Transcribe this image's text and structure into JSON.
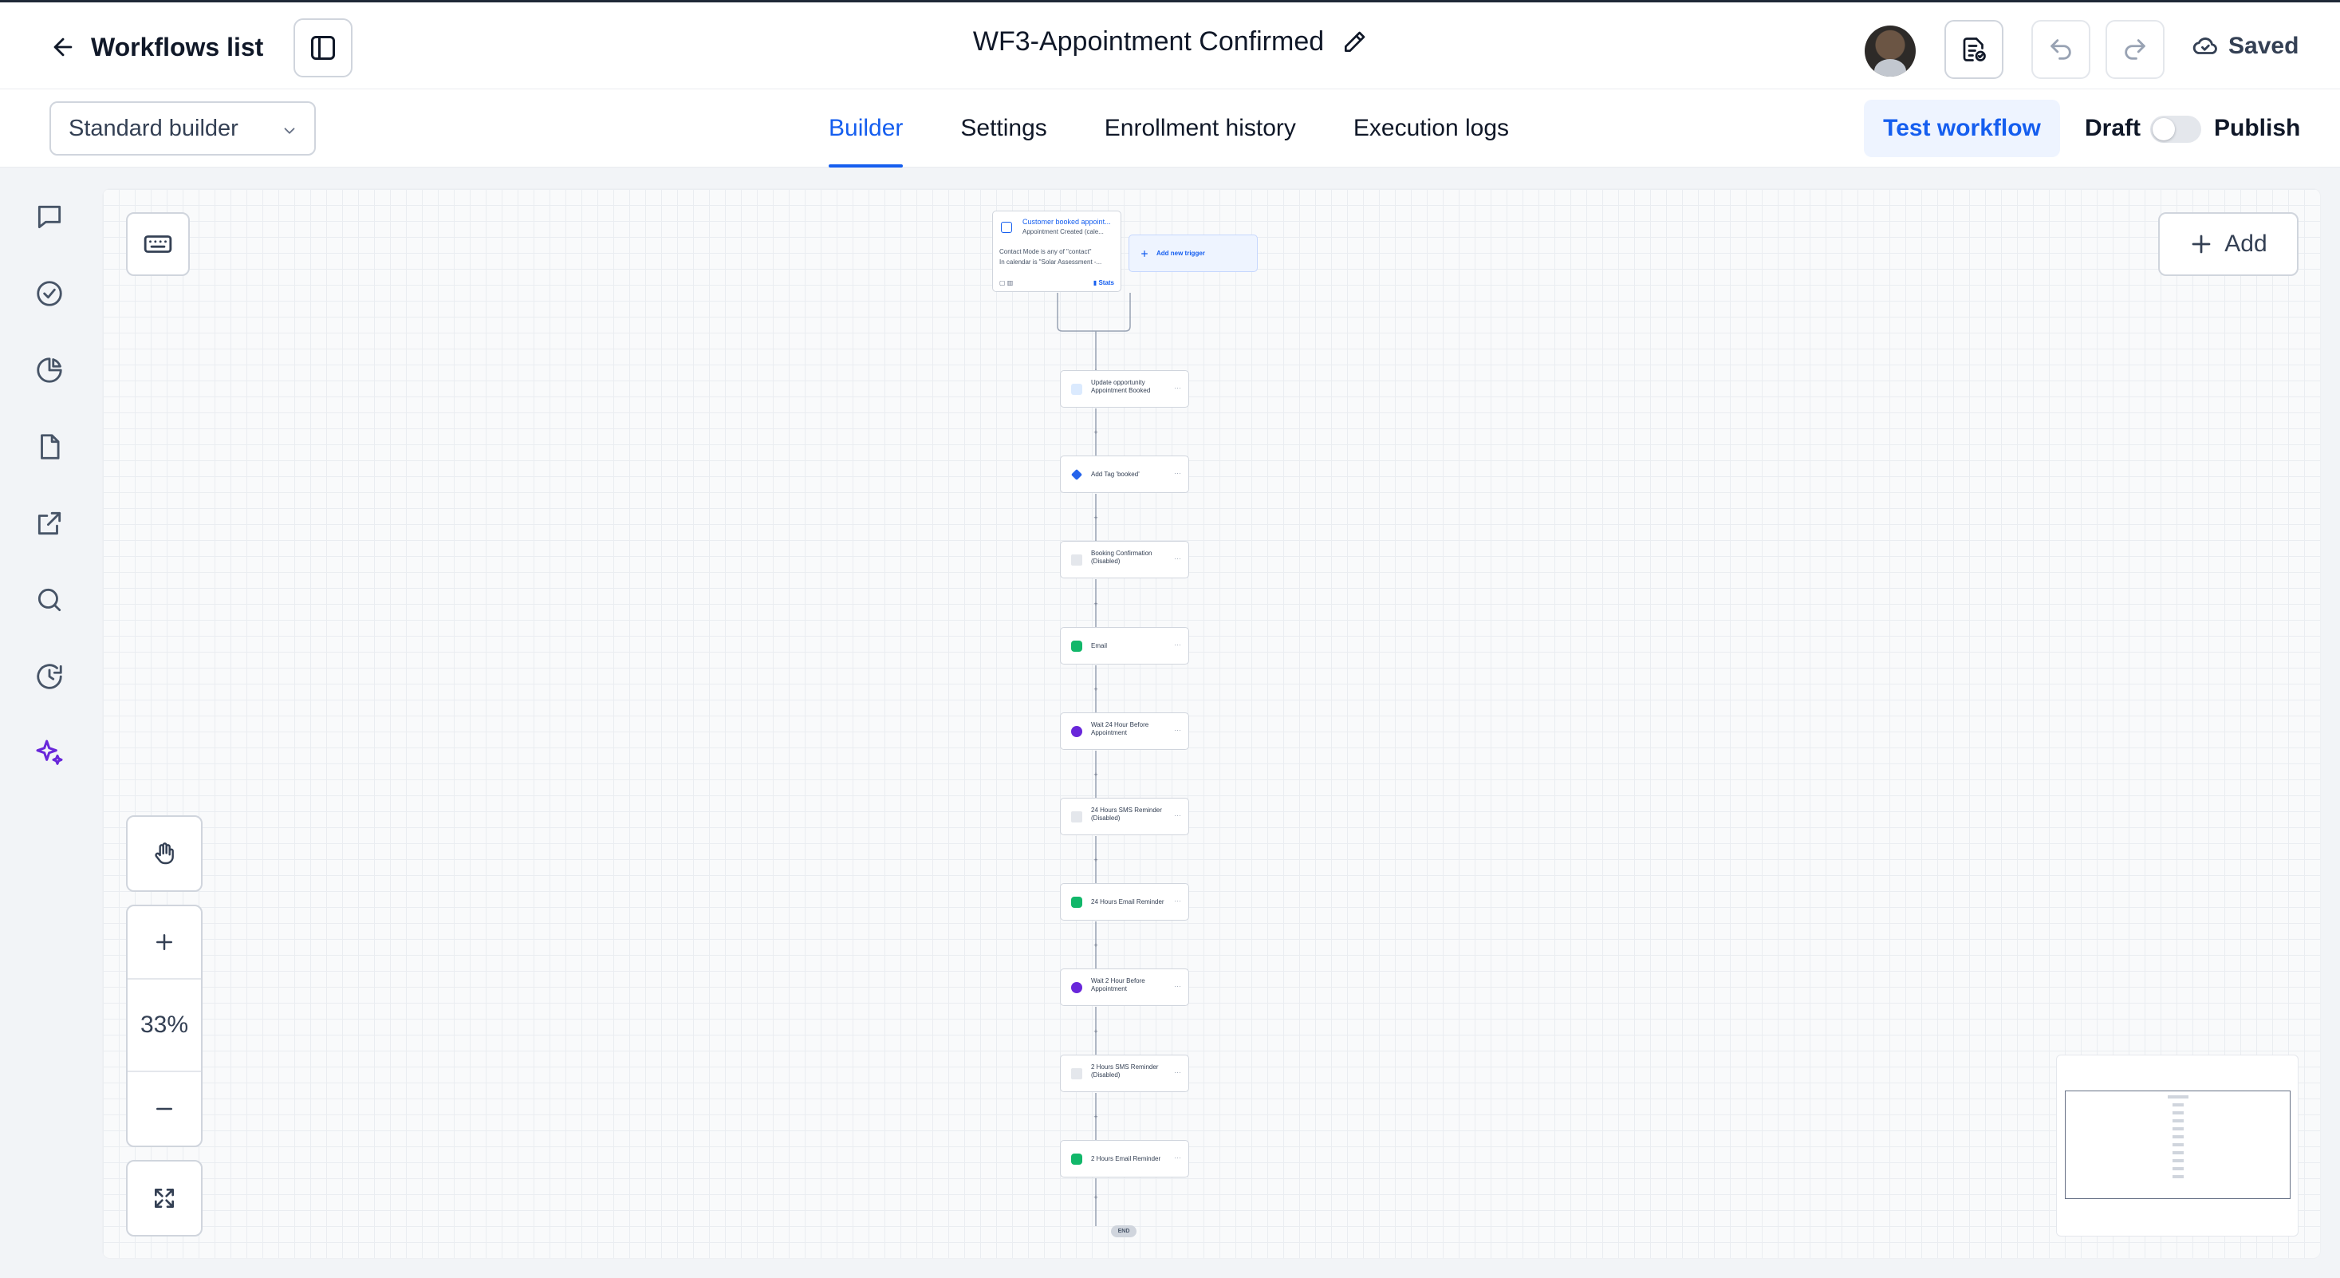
{
  "header": {
    "back_label": "Workflows list",
    "title": "WF3-Appointment Confirmed",
    "save_status": "Saved"
  },
  "subheader": {
    "builder_select": "Standard builder",
    "tabs": [
      {
        "label": "Builder",
        "active": true
      },
      {
        "label": "Settings",
        "active": false
      },
      {
        "label": "Enrollment history",
        "active": false
      },
      {
        "label": "Execution logs",
        "active": false
      }
    ],
    "test_button": "Test workflow",
    "draft_label": "Draft",
    "publish_label": "Publish",
    "publish_toggle_on": false
  },
  "rail": {
    "icons": [
      "chat-icon",
      "check-circle-icon",
      "pie-chart-icon",
      "document-icon",
      "external-link-icon",
      "search-icon",
      "history-icon",
      "sparkles-icon"
    ]
  },
  "canvas": {
    "add_label": "Add",
    "zoom_level": "33%",
    "trigger": {
      "title": "Customer booked appoint...",
      "subtitle": "Appointment Created (cale...",
      "filter_1": "Contact Mode is any of \"contact\"",
      "filter_2": "In calendar is \"Solar Assessment -...",
      "stats_label": "Stats"
    },
    "add_trigger_label": "Add new trigger",
    "steps": [
      {
        "label": "Update opportunity Appointment Booked",
        "type": "opportunity"
      },
      {
        "label": "Add Tag 'booked'",
        "type": "tag"
      },
      {
        "label": "Booking Confirmation (Disabled)",
        "type": "sms"
      },
      {
        "label": "Email",
        "type": "email"
      },
      {
        "label": "Wait 24 Hour Before Appointment",
        "type": "wait"
      },
      {
        "label": "24 Hours SMS Reminder (Disabled)",
        "type": "sms"
      },
      {
        "label": "24 Hours Email Reminder",
        "type": "email"
      },
      {
        "label": "Wait 2 Hour Before Appointment",
        "type": "wait"
      },
      {
        "label": "2 Hours SMS Reminder (Disabled)",
        "type": "sms"
      },
      {
        "label": "2 Hours Email Reminder",
        "type": "email"
      }
    ],
    "end_label": "END"
  },
  "colors": {
    "accent": "#155eef",
    "accent_bg": "#eef4ff",
    "email_icon": "#12b76a",
    "wait_icon": "#6927da",
    "rail_active": "#6927da"
  }
}
